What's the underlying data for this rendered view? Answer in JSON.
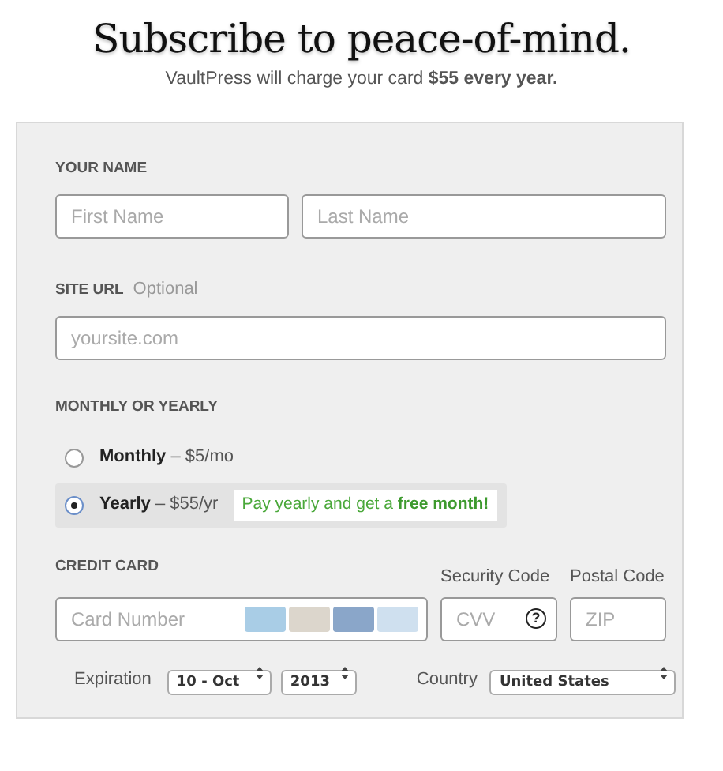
{
  "title": "Subscribe to peace-of-mind.",
  "subtitle": "VaultPress will charge your card **$55 every year.**",
  "name_section": {
    "label": "YOUR NAME",
    "fields": [
      {
        "placeholder": "First Name"
      },
      {
        "placeholder": "Last Name"
      }
    ]
  },
  "site_section": {
    "label": "SITE URL",
    "hint": "Optional",
    "field": {
      "placeholder": "yoursite.com"
    }
  },
  "plan_section": {
    "label": "MONTHLY OR YEARLY",
    "options": [
      {
        "label": "**Monthly** – $5/mo",
        "selected": false
      },
      {
        "label": "**Yearly** – $55/yr",
        "selected": true,
        "promo": "Pay yearly and get a **free month!**"
      }
    ]
  },
  "card_section": {
    "label": "CREDIT CARD",
    "card_field": {
      "placeholder": "Card Number"
    },
    "security": {
      "label": "Security Code",
      "placeholder": "CVV",
      "help": "?"
    },
    "postal": {
      "label": "Postal Code",
      "placeholder": "ZIP"
    },
    "expiration": {
      "label": "Expiration",
      "month": "10 - Oct",
      "year": "2013"
    },
    "country": {
      "label": "Country",
      "value": "United States"
    }
  }
}
